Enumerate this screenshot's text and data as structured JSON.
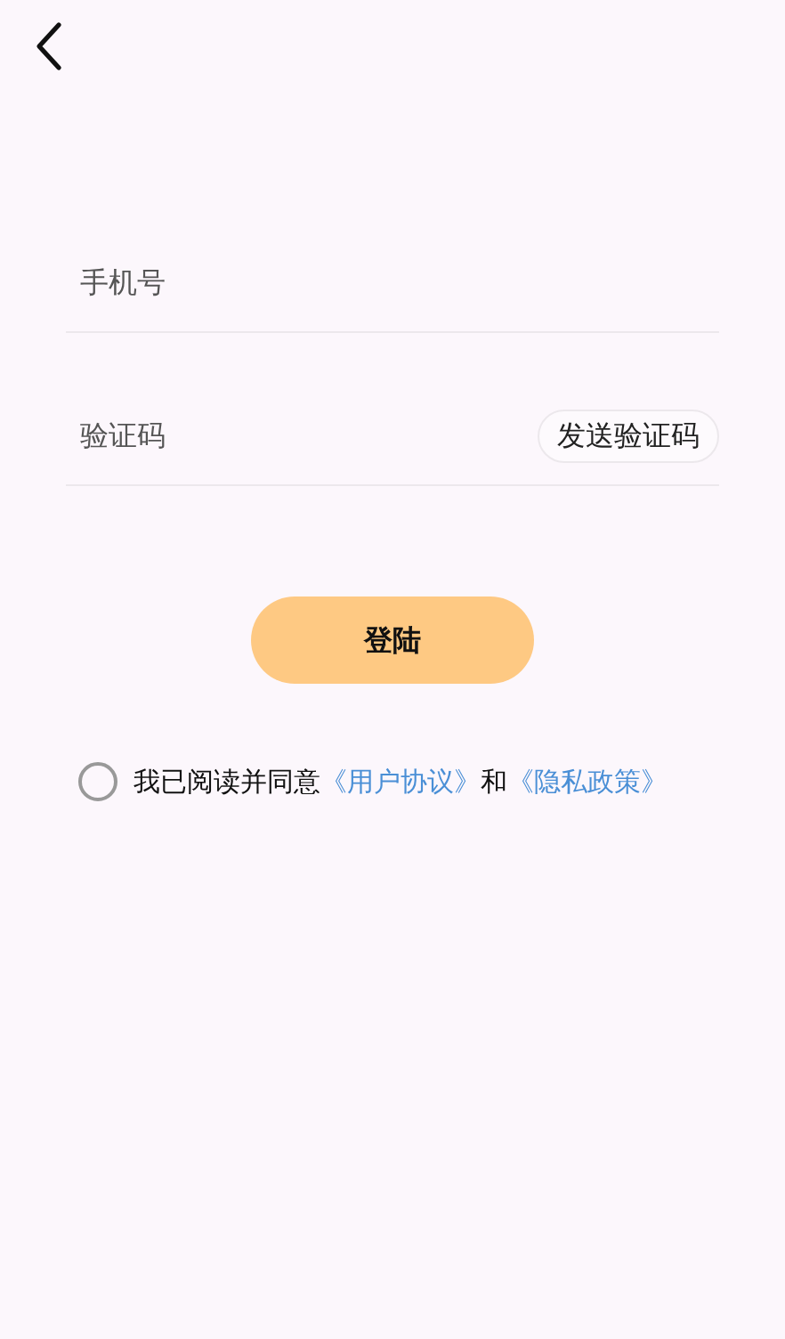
{
  "phone_field": {
    "placeholder": "手机号"
  },
  "code_field": {
    "placeholder": "验证码"
  },
  "send_code_button": "发送验证码",
  "login_button": "登陆",
  "agreement": {
    "checked": false,
    "text": "我已阅读并同意",
    "link_1": "《用户协议》",
    "joiner": "和",
    "link_2": "《隐私政策》"
  }
}
